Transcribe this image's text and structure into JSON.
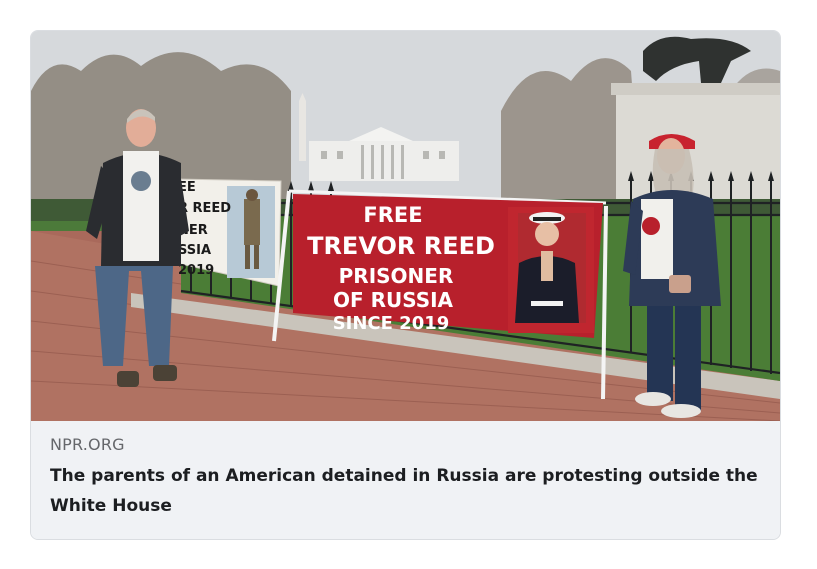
{
  "link_preview": {
    "domain": "NPR.ORG",
    "headline": "The parents of an American detained in Russia are protesting outside the White House",
    "image_alt": "Protesters with Free Trevor Reed banner outside the White House"
  },
  "banner": {
    "line1": "FREE",
    "line2": "TREVOR REED",
    "line3": "PRISONER",
    "line4": "OF RUSSIA",
    "line5": "SINCE 2019"
  },
  "small_sign": {
    "line1": "EE",
    "line2": "R REED",
    "line3": "NER",
    "line4": "SSIA",
    "line5": "2019"
  },
  "colors": {
    "banner_red": "#b8202c",
    "caption_bg": "#f0f2f5",
    "domain_text": "#65676b",
    "headline_text": "#1c1e21"
  }
}
